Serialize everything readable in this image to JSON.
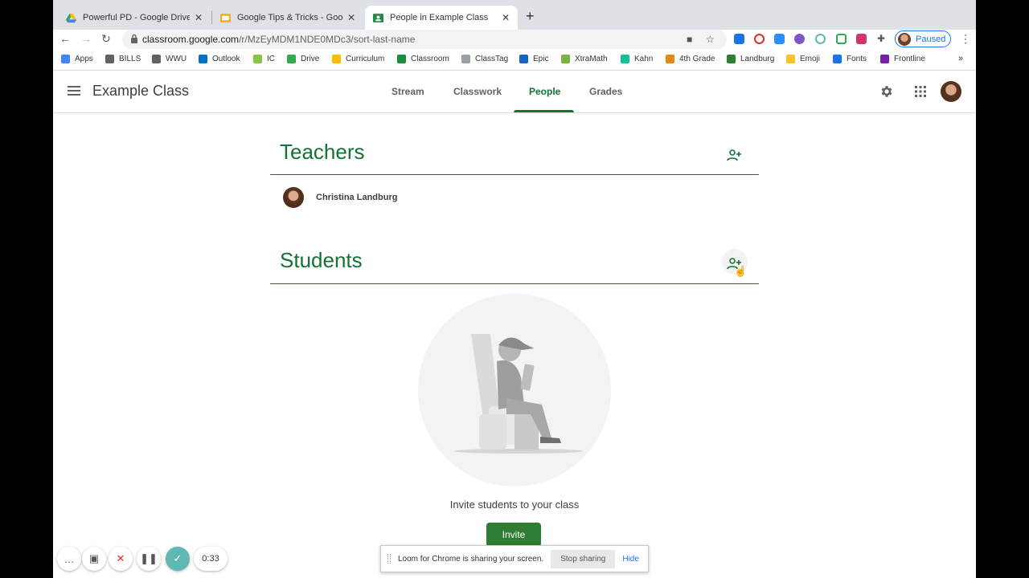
{
  "browser": {
    "tabs": [
      {
        "title": "Powerful PD - Google Drive",
        "icon": "google-drive-icon",
        "active": false
      },
      {
        "title": "Google Tips & Tricks - Google",
        "icon": "google-slides-icon",
        "active": false
      },
      {
        "title": "People in Example Class",
        "icon": "google-classroom-icon",
        "active": true
      }
    ],
    "new_tab_label": "+",
    "url_host": "classroom.google.com",
    "url_path": "/r/MzEyMDM1NDE0MDc3/sort-last-name",
    "profile_status": "Paused",
    "bookmarks": [
      {
        "label": "Apps",
        "icon": "apps-grid-icon",
        "color": "#4285f4"
      },
      {
        "label": "BILLS",
        "icon": "folder-icon",
        "color": "#5f6368"
      },
      {
        "label": "WWU",
        "icon": "folder-icon",
        "color": "#5f6368"
      },
      {
        "label": "Outlook",
        "icon": "outlook-icon",
        "color": "#0072c6"
      },
      {
        "label": "IC",
        "icon": "ic-icon",
        "color": "#8bc34a"
      },
      {
        "label": "Drive",
        "icon": "google-drive-icon",
        "color": "#34a853"
      },
      {
        "label": "Curriculum",
        "icon": "google-drive-icon",
        "color": "#fbbc04"
      },
      {
        "label": "Classroom",
        "icon": "google-classroom-icon",
        "color": "#1e8e3e"
      },
      {
        "label": "ClassTag",
        "icon": "classtag-icon",
        "color": "#9aa0a6"
      },
      {
        "label": "Epic",
        "icon": "epic-icon",
        "color": "#1565c0"
      },
      {
        "label": "XtraMath",
        "icon": "xtramath-icon",
        "color": "#7cb342"
      },
      {
        "label": "Kahn",
        "icon": "khan-academy-icon",
        "color": "#14bf96"
      },
      {
        "label": "4th Grade",
        "icon": "tiger-icon",
        "color": "#e08a1e"
      },
      {
        "label": "Landburg",
        "icon": "cactus-icon",
        "color": "#2e7d32"
      },
      {
        "label": "Emoji",
        "icon": "emoji-icon",
        "color": "#fbc02d"
      },
      {
        "label": "Fonts",
        "icon": "fonts-icon",
        "color": "#1a73e8"
      },
      {
        "label": "Frontline",
        "icon": "frontline-icon",
        "color": "#7b1fa2"
      }
    ],
    "bookmarks_more": "»"
  },
  "classroom": {
    "class_name": "Example Class",
    "tabs": [
      "Stream",
      "Classwork",
      "People",
      "Grades"
    ],
    "active_tab": "People",
    "accent_color": "#137333"
  },
  "people": {
    "teachers_heading": "Teachers",
    "teachers": [
      {
        "name": "Christina Landburg"
      }
    ],
    "students_heading": "Students",
    "empty_message": "Invite students to your class",
    "invite_label": "Invite"
  },
  "share_bar": {
    "message": "Loom for Chrome is sharing your screen.",
    "stop_label": "Stop sharing",
    "hide_label": "Hide"
  },
  "loom": {
    "timer": "0:33"
  }
}
